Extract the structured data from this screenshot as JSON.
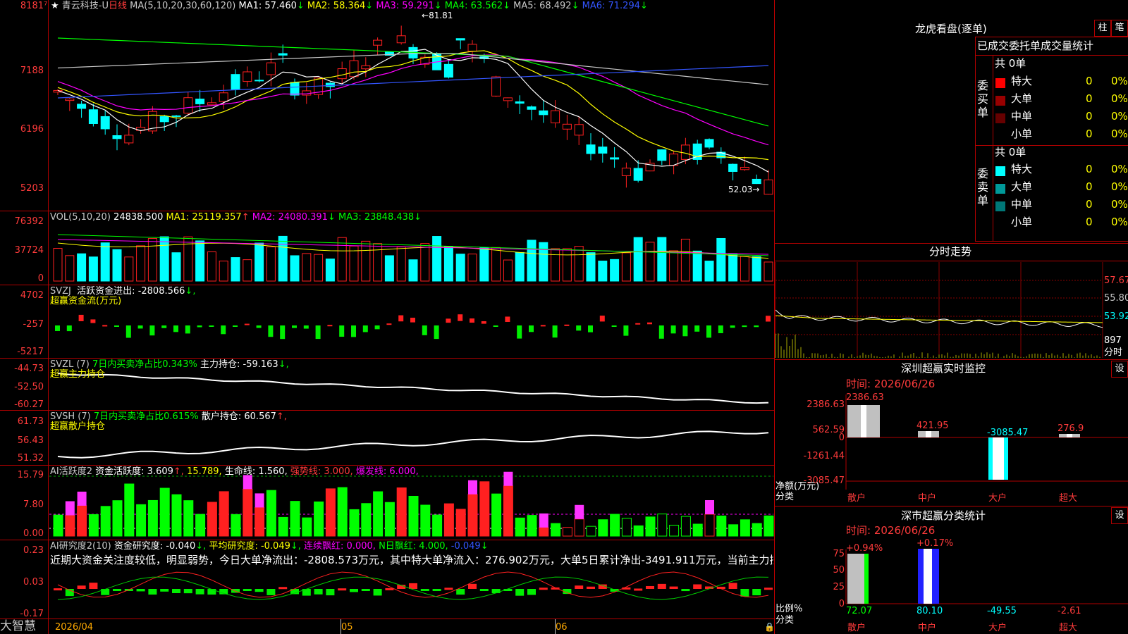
{
  "stock": {
    "star": "★",
    "name": "青云科技-U",
    "period": "日线",
    "ma_params": "MA(5,10,20,30,60,120)",
    "ma": [
      {
        "label": "MA1:",
        "value": "57.460",
        "arrow": "↓",
        "color": "#ffffff"
      },
      {
        "label": "MA2:",
        "value": "58.364",
        "arrow": "↓",
        "color": "#ffff00"
      },
      {
        "label": "MA3:",
        "value": "59.291",
        "arrow": "↓",
        "color": "#ff00ff"
      },
      {
        "label": "MA4:",
        "value": "63.562",
        "arrow": "↓",
        "color": "#00ff00"
      },
      {
        "label": "MA5:",
        "value": "68.492",
        "arrow": "↓",
        "color": "#c8c8c8"
      },
      {
        "label": "MA6:",
        "value": "71.294",
        "arrow": "↓",
        "color": "#3355ff"
      }
    ],
    "high_mark": "81.81",
    "low_mark": "52.03",
    "y_labels": [
      "8181",
      "7188",
      "6196",
      "5203"
    ]
  },
  "vol": {
    "title": "VOL(5,10,20)",
    "value": "24838.500",
    "ma": [
      {
        "label": "MA1:",
        "value": "25119.357",
        "arrow": "↑",
        "color": "#ffff00"
      },
      {
        "label": "MA2:",
        "value": "24080.391",
        "arrow": "↓",
        "color": "#ff00ff"
      },
      {
        "label": "MA3:",
        "value": "23848.438",
        "arrow": "↓",
        "color": "#00ff00"
      }
    ],
    "y_labels": [
      "76392",
      "37724",
      "0"
    ]
  },
  "svzj": {
    "title": "SVZJ",
    "label": "活跃资金进出:",
    "value": "-2808.566",
    "arrow": "↓,",
    "subtitle": "超赢资金流(万元)",
    "y_labels": [
      "4702",
      "-257",
      "-5217"
    ]
  },
  "svzl": {
    "title": "SVZL (7)",
    "desc": "7日内买卖净占比0.343%",
    "label": "主力持仓:",
    "value": "-59.163",
    "arrow": "↓,",
    "subtitle": "超赢主力持仓",
    "y_labels": [
      "-44.73",
      "-52.50",
      "-60.27"
    ]
  },
  "svsh": {
    "title": "SVSH (7)",
    "desc": "7日内买卖净占比0.615%",
    "label": "散户持仓:",
    "value": "60.567",
    "arrow": "↑,",
    "subtitle": "超赢散户持仓",
    "y_labels": [
      "61.73",
      "56.43",
      "51.32"
    ]
  },
  "ai_active": {
    "title": "AI活跃度2",
    "label": "资金活跃度:",
    "value": "3.609",
    "arrow": "↑,",
    "v2": "15.789,",
    "life_label": "生命线:",
    "life_value": "1.560,",
    "strong": "强势线: 3.000,",
    "burst": "爆发线: 6.000,",
    "y_labels": [
      "15.79",
      "7.80",
      "0.00"
    ]
  },
  "ai_research": {
    "title": "AI研究度2(10)",
    "label": "资金研究度:",
    "value": "-0.040",
    "arrow": "↓,",
    "avg": "平均研究度: -0.049",
    "avg_arrow": "↓,",
    "red": "连续飘红: 0.000,",
    "nred": "N日飘红: 4.000,",
    "last": "-0.049",
    "last_arrow": "↓",
    "comment": "近期大资金关注度较低，明显弱势，今日大单净流出：-2808.573万元，其中特大单净流入：276.902万元，大单5日累计净出-3491.911万元，当前主力控盘",
    "y_labels": [
      "0.23",
      "0.03",
      "-0.17"
    ]
  },
  "bottom": {
    "logo": "大智慧",
    "dates": [
      "2026/04",
      "05",
      "06"
    ]
  },
  "right": {
    "lhb_title": "龙虎看盘(逐单)",
    "btn_zhu": "柱",
    "btn_bi": "笔",
    "tabs": [
      "已成交",
      "委托单",
      "成交量统计"
    ],
    "buy_side": "委买单",
    "sell_side": "委卖单",
    "buy_total": "共 0单",
    "sell_total": "共 0单",
    "buy_rows": [
      {
        "label": "特大",
        "count": "0",
        "pct": "0%",
        "color": "#ff0000"
      },
      {
        "label": "大单",
        "count": "0",
        "pct": "0%",
        "color": "#990000"
      },
      {
        "label": "中单",
        "count": "0",
        "pct": "0%",
        "color": "#660000"
      },
      {
        "label": "小单",
        "count": "0",
        "pct": "0%",
        "color": "#000000"
      }
    ],
    "sell_rows": [
      {
        "label": "特大",
        "count": "0",
        "pct": "0%",
        "color": "#00ffff"
      },
      {
        "label": "大单",
        "count": "0",
        "pct": "0%",
        "color": "#009999"
      },
      {
        "label": "中单",
        "count": "0",
        "pct": "0%",
        "color": "#007777"
      },
      {
        "label": "小单",
        "count": "0",
        "pct": "0%",
        "color": "#000000"
      }
    ],
    "fs_title": "分时走势",
    "fs_labels": [
      "57.67",
      "55.80",
      "53.92",
      "897",
      "分时"
    ],
    "monitor_title": "深圳超赢实时监控",
    "monitor_btn": "设",
    "monitor_time": "时间: 2026/06/26",
    "monitor_y": [
      "2386.63",
      "562.59",
      "0",
      "-1261.44",
      "-3085.47"
    ],
    "monitor_ylabel": "净额(万元)",
    "monitor_xlabel": "分类",
    "monitor_cats": [
      "散户",
      "中户",
      "大户",
      "超大"
    ],
    "monitor_values": [
      "2386.63",
      "421.95",
      "-3085.47",
      "276.9"
    ],
    "class_title": "深市超赢分类统计",
    "class_btn": "设",
    "class_time": "时间: 2026/06/26",
    "class_y": [
      "75",
      "50",
      "25",
      "0"
    ],
    "class_ylabel": "比例%",
    "class_xlabel": "分类",
    "class_top": [
      "+0.94%",
      "+0.17%"
    ],
    "class_cats": [
      "散户",
      "中户",
      "大户",
      "超大"
    ],
    "class_values": [
      "72.07",
      "80.10",
      "-49.55",
      "-2.61"
    ]
  }
}
